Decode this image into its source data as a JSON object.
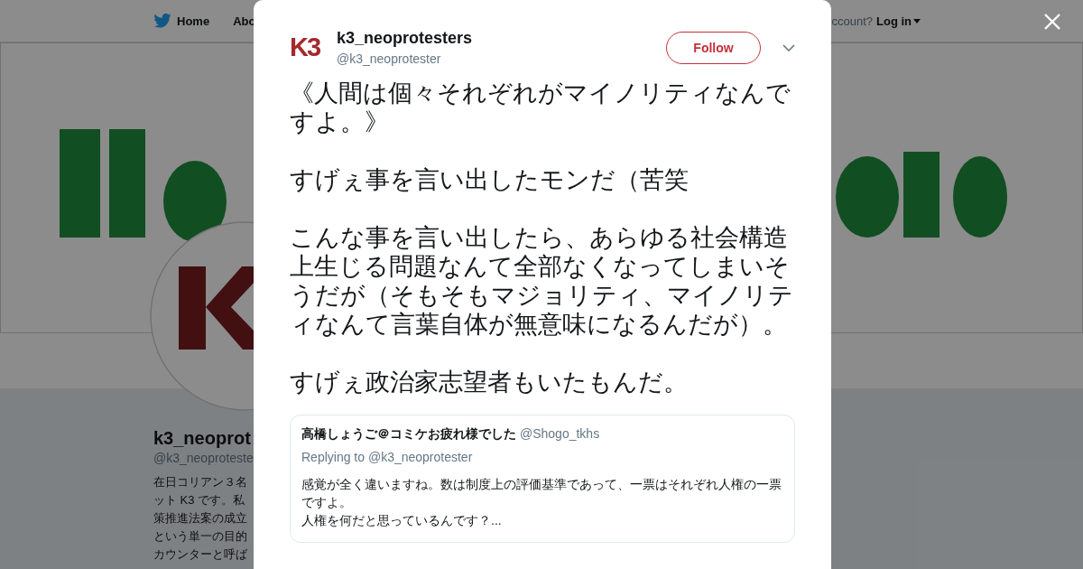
{
  "nav": {
    "items": [
      {
        "label": "Home",
        "kind": "home"
      },
      {
        "label": "Abo",
        "kind": "plain"
      }
    ],
    "account_prompt": "ccount?",
    "login": "Log in"
  },
  "profile": {
    "name": "k3_neoprot",
    "handle": "@k3_neoproteste",
    "bio": [
      "在日コリアン３名",
      "ット K3 です。私",
      "策推進法案の成立",
      "という単一の目的",
      "カウンターと呼ば"
    ]
  },
  "tweet": {
    "avatar_text": "K3",
    "name": "k3_neoprotesters",
    "handle": "@k3_neoprotester",
    "follow": "Follow",
    "paragraphs": [
      "《人間は個々それぞれがマイノリティなんですよ。》",
      "すげぇ事を言い出したモンだ（苦笑",
      "こんな事を言い出したら、あらゆる社会構造上生じる問題なんて全部なくなってしまいそうだが（そもそもマジョリティ、マイノリティなんて言葉自体が無意味になるんだが）。",
      "すげぇ政治家志望者もいたもんだ。"
    ],
    "quote": {
      "name": "高橋しょうご＠コミケお疲れ様でした",
      "handle": "@Shogo_tkhs",
      "replying": "Replying to @k3_neoprotester",
      "lines": [
        "感覚が全く違いますね。数は制度上の評価基準であって、一票はそれぞれ人権の一票ですよ。",
        "人権を何だと思っているんです？..."
      ]
    }
  }
}
